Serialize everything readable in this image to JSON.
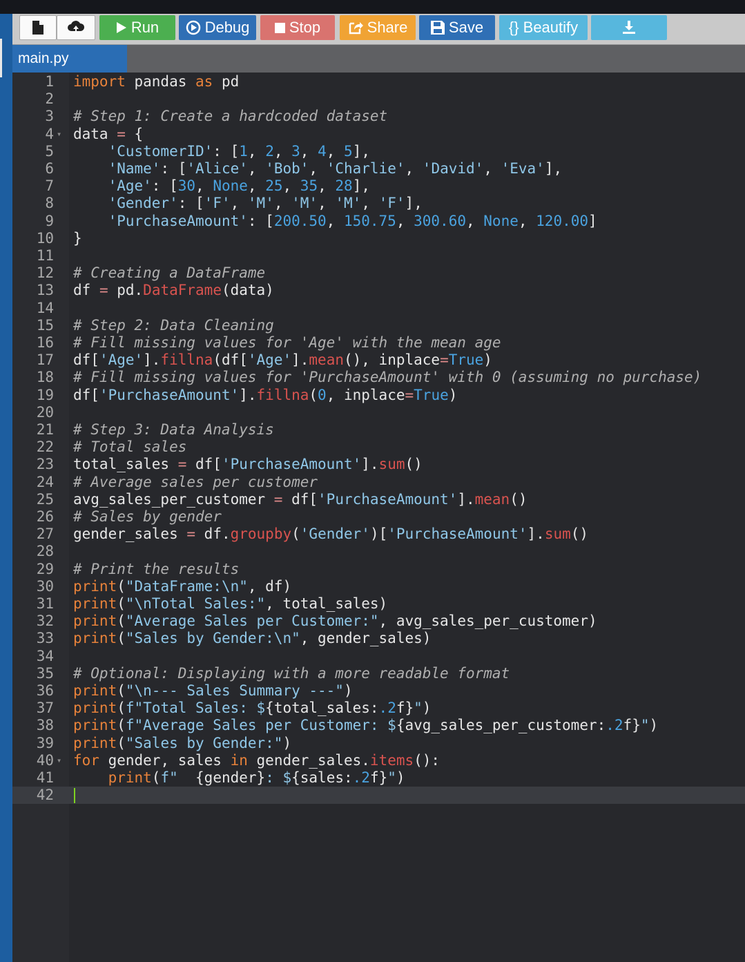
{
  "toolbar": {
    "run_label": "Run",
    "debug_label": "Debug",
    "stop_label": "Stop",
    "share_label": "Share",
    "save_label": "Save",
    "beautify_label": "{} Beautify"
  },
  "colors": {
    "run": "#4caf50",
    "debug": "#2f6fb5",
    "stop": "#d9736f",
    "share": "#f0a334",
    "save": "#2f6fb5",
    "beautify": "#57b7dd",
    "download": "#57b7dd",
    "tab_active": "#2a6db4"
  },
  "icons": [
    "new-file-icon",
    "upload-cloud-icon",
    "play-icon",
    "debug-circle-icon",
    "stop-square-icon",
    "share-icon",
    "save-floppy-icon",
    "download-icon"
  ],
  "tab": {
    "label": "main.py"
  },
  "editor": {
    "cursor_line": 42,
    "lines": [
      [
        [
          "kw",
          "import"
        ],
        [
          "tx",
          " pandas "
        ],
        [
          "kw",
          "as"
        ],
        [
          "tx",
          " pd"
        ]
      ],
      [],
      [
        [
          "cm",
          "# Step 1: Create a hardcoded dataset"
        ]
      ],
      [
        [
          "tx",
          "data "
        ],
        [
          "op",
          "="
        ],
        [
          "tx",
          " {"
        ]
      ],
      [
        [
          "tx",
          "    "
        ],
        [
          "st",
          "'CustomerID'"
        ],
        [
          "tx",
          ": ["
        ],
        [
          "nm",
          "1"
        ],
        [
          "tx",
          ", "
        ],
        [
          "nm",
          "2"
        ],
        [
          "tx",
          ", "
        ],
        [
          "nm",
          "3"
        ],
        [
          "tx",
          ", "
        ],
        [
          "nm",
          "4"
        ],
        [
          "tx",
          ", "
        ],
        [
          "nm",
          "5"
        ],
        [
          "tx",
          "],"
        ]
      ],
      [
        [
          "tx",
          "    "
        ],
        [
          "st",
          "'Name'"
        ],
        [
          "tx",
          ": ["
        ],
        [
          "st",
          "'Alice'"
        ],
        [
          "tx",
          ", "
        ],
        [
          "st",
          "'Bob'"
        ],
        [
          "tx",
          ", "
        ],
        [
          "st",
          "'Charlie'"
        ],
        [
          "tx",
          ", "
        ],
        [
          "st",
          "'David'"
        ],
        [
          "tx",
          ", "
        ],
        [
          "st",
          "'Eva'"
        ],
        [
          "tx",
          "],"
        ]
      ],
      [
        [
          "tx",
          "    "
        ],
        [
          "st",
          "'Age'"
        ],
        [
          "tx",
          ": ["
        ],
        [
          "nm",
          "30"
        ],
        [
          "tx",
          ", "
        ],
        [
          "nm",
          "None"
        ],
        [
          "tx",
          ", "
        ],
        [
          "nm",
          "25"
        ],
        [
          "tx",
          ", "
        ],
        [
          "nm",
          "35"
        ],
        [
          "tx",
          ", "
        ],
        [
          "nm",
          "28"
        ],
        [
          "tx",
          "],"
        ]
      ],
      [
        [
          "tx",
          "    "
        ],
        [
          "st",
          "'Gender'"
        ],
        [
          "tx",
          ": ["
        ],
        [
          "st",
          "'F'"
        ],
        [
          "tx",
          ", "
        ],
        [
          "st",
          "'M'"
        ],
        [
          "tx",
          ", "
        ],
        [
          "st",
          "'M'"
        ],
        [
          "tx",
          ", "
        ],
        [
          "st",
          "'M'"
        ],
        [
          "tx",
          ", "
        ],
        [
          "st",
          "'F'"
        ],
        [
          "tx",
          "],"
        ]
      ],
      [
        [
          "tx",
          "    "
        ],
        [
          "st",
          "'PurchaseAmount'"
        ],
        [
          "tx",
          ": ["
        ],
        [
          "nm",
          "200.50"
        ],
        [
          "tx",
          ", "
        ],
        [
          "nm",
          "150.75"
        ],
        [
          "tx",
          ", "
        ],
        [
          "nm",
          "300.60"
        ],
        [
          "tx",
          ", "
        ],
        [
          "nm",
          "None"
        ],
        [
          "tx",
          ", "
        ],
        [
          "nm",
          "120.00"
        ],
        [
          "tx",
          "]"
        ]
      ],
      [
        [
          "tx",
          "}"
        ]
      ],
      [],
      [
        [
          "cm",
          "# Creating a DataFrame"
        ]
      ],
      [
        [
          "tx",
          "df "
        ],
        [
          "op",
          "="
        ],
        [
          "tx",
          " pd."
        ],
        [
          "fn",
          "DataFrame"
        ],
        [
          "tx",
          "(data)"
        ]
      ],
      [],
      [
        [
          "cm",
          "# Step 2: Data Cleaning"
        ]
      ],
      [
        [
          "cm",
          "# Fill missing values for 'Age' with the mean age"
        ]
      ],
      [
        [
          "tx",
          "df["
        ],
        [
          "st",
          "'Age'"
        ],
        [
          "tx",
          "]."
        ],
        [
          "fn",
          "fillna"
        ],
        [
          "tx",
          "(df["
        ],
        [
          "st",
          "'Age'"
        ],
        [
          "tx",
          "]."
        ],
        [
          "fn",
          "mean"
        ],
        [
          "tx",
          "(), inplace"
        ],
        [
          "op",
          "="
        ],
        [
          "nm",
          "True"
        ],
        [
          "tx",
          ")"
        ]
      ],
      [
        [
          "cm",
          "# Fill missing values for 'PurchaseAmount' with 0 (assuming no purchase)"
        ]
      ],
      [
        [
          "tx",
          "df["
        ],
        [
          "st",
          "'PurchaseAmount'"
        ],
        [
          "tx",
          "]."
        ],
        [
          "fn",
          "fillna"
        ],
        [
          "tx",
          "("
        ],
        [
          "nm",
          "0"
        ],
        [
          "tx",
          ", inplace"
        ],
        [
          "op",
          "="
        ],
        [
          "nm",
          "True"
        ],
        [
          "tx",
          ")"
        ]
      ],
      [],
      [
        [
          "cm",
          "# Step 3: Data Analysis"
        ]
      ],
      [
        [
          "cm",
          "# Total sales"
        ]
      ],
      [
        [
          "tx",
          "total_sales "
        ],
        [
          "op",
          "="
        ],
        [
          "tx",
          " df["
        ],
        [
          "st",
          "'PurchaseAmount'"
        ],
        [
          "tx",
          "]."
        ],
        [
          "fn",
          "sum"
        ],
        [
          "tx",
          "()"
        ]
      ],
      [
        [
          "cm",
          "# Average sales per customer"
        ]
      ],
      [
        [
          "tx",
          "avg_sales_per_customer "
        ],
        [
          "op",
          "="
        ],
        [
          "tx",
          " df["
        ],
        [
          "st",
          "'PurchaseAmount'"
        ],
        [
          "tx",
          "]."
        ],
        [
          "fn",
          "mean"
        ],
        [
          "tx",
          "()"
        ]
      ],
      [
        [
          "cm",
          "# Sales by gender"
        ]
      ],
      [
        [
          "tx",
          "gender_sales "
        ],
        [
          "op",
          "="
        ],
        [
          "tx",
          " df."
        ],
        [
          "fn",
          "groupby"
        ],
        [
          "tx",
          "("
        ],
        [
          "st",
          "'Gender'"
        ],
        [
          "tx",
          ")["
        ],
        [
          "st",
          "'PurchaseAmount'"
        ],
        [
          "tx",
          "]."
        ],
        [
          "fn",
          "sum"
        ],
        [
          "tx",
          "()"
        ]
      ],
      [],
      [
        [
          "cm",
          "# Print the results"
        ]
      ],
      [
        [
          "kw",
          "print"
        ],
        [
          "tx",
          "("
        ],
        [
          "st",
          "\"DataFrame:\\n\""
        ],
        [
          "tx",
          ", df)"
        ]
      ],
      [
        [
          "kw",
          "print"
        ],
        [
          "tx",
          "("
        ],
        [
          "st",
          "\"\\nTotal Sales:\""
        ],
        [
          "tx",
          ", total_sales)"
        ]
      ],
      [
        [
          "kw",
          "print"
        ],
        [
          "tx",
          "("
        ],
        [
          "st",
          "\"Average Sales per Customer:\""
        ],
        [
          "tx",
          ", avg_sales_per_customer)"
        ]
      ],
      [
        [
          "kw",
          "print"
        ],
        [
          "tx",
          "("
        ],
        [
          "st",
          "\"Sales by Gender:\\n\""
        ],
        [
          "tx",
          ", gender_sales)"
        ]
      ],
      [],
      [
        [
          "cm",
          "# Optional: Displaying with a more readable format"
        ]
      ],
      [
        [
          "kw",
          "print"
        ],
        [
          "tx",
          "("
        ],
        [
          "st",
          "\"\\n--- Sales Summary ---\""
        ],
        [
          "tx",
          ")"
        ]
      ],
      [
        [
          "kw",
          "print"
        ],
        [
          "tx",
          "("
        ],
        [
          "st",
          "f\"Total Sales: $"
        ],
        [
          "tx",
          "{total_sales:"
        ],
        [
          "nm",
          ".2"
        ],
        [
          "tx",
          "f}"
        ],
        [
          "st",
          "\""
        ],
        [
          "tx",
          ")"
        ]
      ],
      [
        [
          "kw",
          "print"
        ],
        [
          "tx",
          "("
        ],
        [
          "st",
          "f\"Average Sales per Customer: $"
        ],
        [
          "tx",
          "{avg_sales_per_customer:"
        ],
        [
          "nm",
          ".2"
        ],
        [
          "tx",
          "f}"
        ],
        [
          "st",
          "\""
        ],
        [
          "tx",
          ")"
        ]
      ],
      [
        [
          "kw",
          "print"
        ],
        [
          "tx",
          "("
        ],
        [
          "st",
          "\"Sales by Gender:\""
        ],
        [
          "tx",
          ")"
        ]
      ],
      [
        [
          "kw",
          "for"
        ],
        [
          "tx",
          " gender, sales "
        ],
        [
          "kw",
          "in"
        ],
        [
          "tx",
          " gender_sales."
        ],
        [
          "fn",
          "items"
        ],
        [
          "tx",
          "():"
        ]
      ],
      [
        [
          "tx",
          "    "
        ],
        [
          "kw",
          "print"
        ],
        [
          "tx",
          "("
        ],
        [
          "st",
          "f\"  "
        ],
        [
          "tx",
          "{gender}"
        ],
        [
          "st",
          ": $"
        ],
        [
          "tx",
          "{sales:"
        ],
        [
          "nm",
          ".2"
        ],
        [
          "tx",
          "f}"
        ],
        [
          "st",
          "\""
        ],
        [
          "tx",
          ")"
        ]
      ],
      []
    ],
    "folds": [
      4,
      40
    ]
  }
}
